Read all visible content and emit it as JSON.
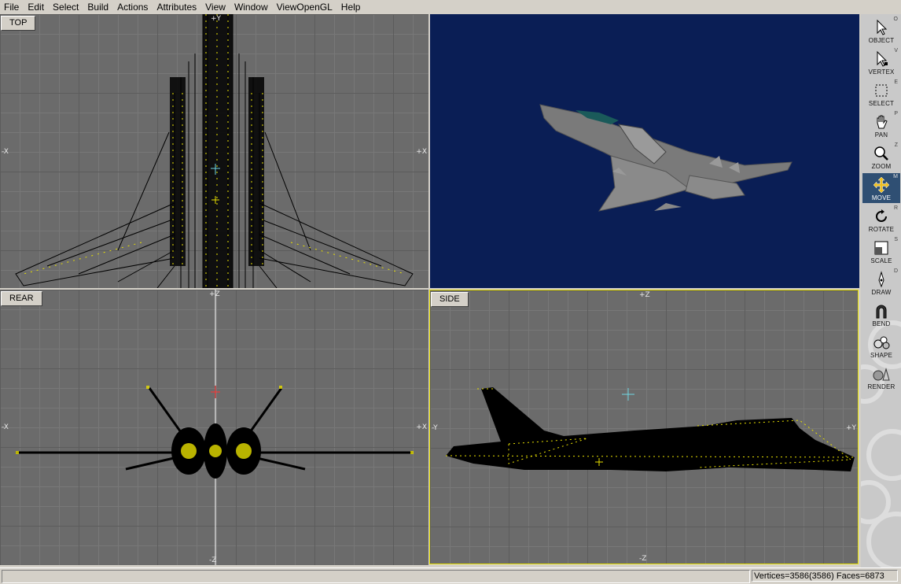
{
  "menu": {
    "items": [
      "File",
      "Edit",
      "Select",
      "Build",
      "Actions",
      "Attributes",
      "View",
      "Window",
      "ViewOpenGL",
      "Help"
    ]
  },
  "viewports": {
    "top": {
      "label": "TOP",
      "axes": {
        "left": "-X",
        "right": "+X",
        "top": "+Y"
      }
    },
    "perspective": {
      "label": ""
    },
    "rear": {
      "label": "REAR",
      "axes": {
        "left": "-X",
        "right": "+X",
        "top": "+Z",
        "bottom": "-Z"
      }
    },
    "side": {
      "label": "SIDE",
      "axes": {
        "left": "-Y",
        "right": "+Y",
        "top": "+Z",
        "bottom": "-Z"
      }
    }
  },
  "toolbar": {
    "tools": [
      {
        "label": "OBJECT",
        "hotkey": "O",
        "icon": "object-arrow-icon"
      },
      {
        "label": "VERTEX",
        "hotkey": "V",
        "icon": "vertex-arrow-icon"
      },
      {
        "label": "SELECT",
        "hotkey": "E",
        "icon": "select-box-icon"
      },
      {
        "label": "PAN",
        "hotkey": "P",
        "icon": "pan-hand-icon"
      },
      {
        "label": "ZOOM",
        "hotkey": "Z",
        "icon": "zoom-magnifier-icon"
      },
      {
        "label": "MOVE",
        "hotkey": "M",
        "icon": "move-arrows-icon",
        "active": true
      },
      {
        "label": "ROTATE",
        "hotkey": "R",
        "icon": "rotate-icon"
      },
      {
        "label": "SCALE",
        "hotkey": "S",
        "icon": "scale-icon"
      },
      {
        "label": "DRAW",
        "hotkey": "D",
        "icon": "draw-pen-icon"
      },
      {
        "label": "BEND",
        "hotkey": "",
        "icon": "bend-magnet-icon"
      },
      {
        "label": "SHAPE",
        "hotkey": "",
        "icon": "shape-spheres-icon"
      },
      {
        "label": "RENDER",
        "hotkey": "",
        "icon": "render-teapot-icon"
      }
    ]
  },
  "status": {
    "message": "",
    "counts": "Vertices=3586(3586) Faces=6873"
  },
  "colors": {
    "viewport_bg": "#6b6b6b",
    "perspective_bg": "#0a1e55",
    "wire_selected": "#e8e000",
    "wire": "#000000",
    "active_tool": "#2f4f73"
  }
}
